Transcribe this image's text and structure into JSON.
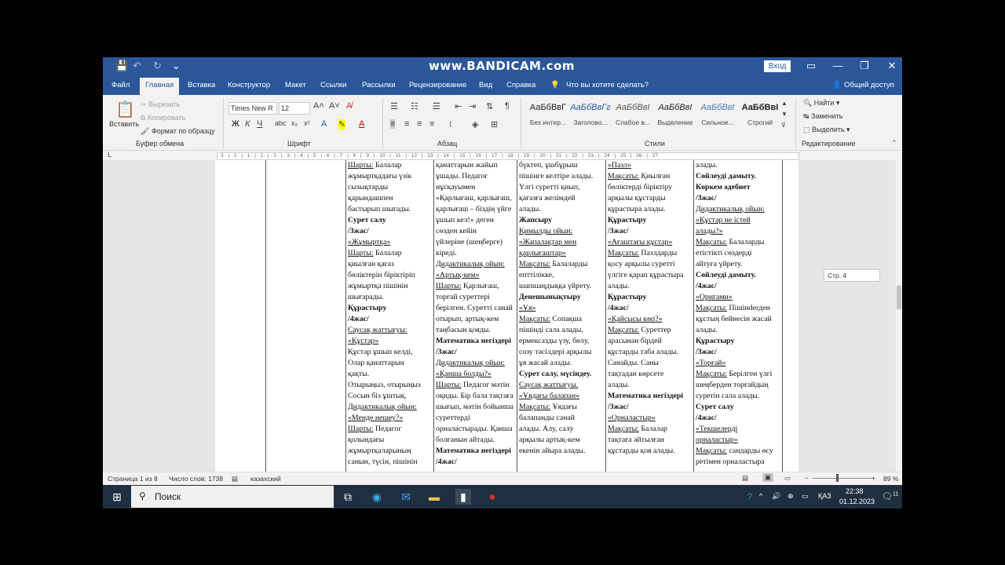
{
  "titlebar": {
    "watermark": "www.BANDICAM.com",
    "sign_in": "Вход",
    "qat_save": "💾",
    "qat_undo": "↶",
    "qat_redo": "↻",
    "qat_more": "⌄",
    "win_ribbon": "▭",
    "win_min": "—",
    "win_max": "❐",
    "win_close": "✕"
  },
  "tabs": [
    "Файл",
    "Главная",
    "Вставка",
    "Конструктор",
    "Макет",
    "Ссылки",
    "Рассылки",
    "Рецензирование",
    "Вид",
    "Справка"
  ],
  "tell_me": "Что вы хотите сделать?",
  "share": "Общий доступ",
  "ribbon": {
    "clipboard": {
      "label": "Буфер обмена",
      "paste": "Вставить",
      "cut": "Вырезать",
      "copy": "Копировать",
      "format_painter": "Формат по образцу"
    },
    "font": {
      "label": "Шрифт",
      "name": "Times New R",
      "size": "12"
    },
    "paragraph": {
      "label": "Абзац"
    },
    "styles": {
      "label": "Стили",
      "items": [
        {
          "sample": "АаБбВвГ",
          "name": "Без интер..."
        },
        {
          "sample": "АаБбВвГг",
          "name": "Заголово..."
        },
        {
          "sample": "АаБбВвІ",
          "name": "Слабое в..."
        },
        {
          "sample": "АаБбВвІ",
          "name": "Выделение"
        },
        {
          "sample": "АаБбВвІ",
          "name": "Сильное..."
        },
        {
          "sample": "АаБбВвІ",
          "name": "Строгий"
        }
      ]
    },
    "editing": {
      "label": "Редактирование",
      "find": "Найти",
      "replace": "Заменить",
      "select": "Выделить"
    }
  },
  "ruler": "· 3 · | · 2 · | · 1 · | · 1 · | · 2 · | · 3 · | · 4 · | · 5 · | · 6 · | · 7 · | · 8 · | · 9 · | · 10 · | · 11 · | · 12 · | · 13 · | · 14 · | · 15 · | · 16 · | · 17 · | · 18 · | · 19 · | · 20 · | · 21 · | · 22 · | · 23 · | · 24 · | · 25 · | · 26 · | · 27",
  "page_tip": "Стр. 4",
  "columns": [
    [
      {
        "t": "Шарты: Балалар",
        "s": "u1"
      },
      {
        "t": "жұмыртқадағы үзік"
      },
      {
        "t": "сызықтарды"
      },
      {
        "t": "қарындашпен"
      },
      {
        "t": "бастырып шығады."
      },
      {
        "t": "Сурет салу",
        "s": "b"
      },
      {
        "t": "/3жас/",
        "s": "b"
      },
      {
        "t": "«Жұмыртқа»",
        "s": "u"
      },
      {
        "t": "Шарты: Балалар",
        "s": "u1"
      },
      {
        "t": "қиылған қағаз"
      },
      {
        "t": "бөліктерін біріктіріп"
      },
      {
        "t": "жұмыртқа пішінін"
      },
      {
        "t": "шығарады."
      },
      {
        "t": "Құрастыру",
        "s": "b"
      },
      {
        "t": "/4жас/",
        "s": "b"
      },
      {
        "t": "Саусақ жаттығуы:",
        "s": "u"
      },
      {
        "t": "«Құстар»",
        "s": "u"
      },
      {
        "t": "Құстар ұшып келді,"
      },
      {
        "t": "Олар қанаттарын"
      },
      {
        "t": "қақты."
      },
      {
        "t": "Отырыңыз, отырыңыз"
      },
      {
        "t": "Сосын біз ұштық."
      },
      {
        "t": "Дидактикалық ойын:",
        "s": "u"
      },
      {
        "t": "«Менде нешеу?»",
        "s": "u"
      },
      {
        "t": "Шарты: Педагог",
        "s": "u1"
      },
      {
        "t": "қолындағы"
      },
      {
        "t": "жұмыртқаларының"
      },
      {
        "t": "санын, түсін, пішінін"
      }
    ],
    [
      {
        "t": "қанаттарын жайып"
      },
      {
        "t": "ұшады.  Педагог"
      },
      {
        "t": "нұсқауымен"
      },
      {
        "t": "«Қарлығаш, қарлығаш,"
      },
      {
        "t": "қарлығаш – біздің үйге"
      },
      {
        "t": "ұшып кел!» деген"
      },
      {
        "t": "сөзден кейін"
      },
      {
        "t": "үйлеріне (шеңберге)"
      },
      {
        "t": "кіреді."
      },
      {
        "t": "Дидактикалық ойын:",
        "s": "u"
      },
      {
        "t": "«Артық-кем»",
        "s": "u"
      },
      {
        "t": "Шарты: Қарлығаш,",
        "s": "u1"
      },
      {
        "t": "торғай суреттері"
      },
      {
        "t": "берілген. Суретті санай"
      },
      {
        "t": "отырып, артық-кем"
      },
      {
        "t": "таңбасын қояды."
      },
      {
        "t": "Математика негіздері",
        "s": "b"
      },
      {
        "t": "/3жас/",
        "s": "b"
      },
      {
        "t": "Дидактикалық ойын:",
        "s": "u"
      },
      {
        "t": "«Қанша болды?»",
        "s": "u"
      },
      {
        "t": "Шарты: Педагог мәтін",
        "s": "u1"
      },
      {
        "t": "оқиды. Бір бала тақтаға"
      },
      {
        "t": "шығып, мәтін бойынша"
      },
      {
        "t": "суреттерді"
      },
      {
        "t": "орналастырады. Қанша"
      },
      {
        "t": "болғанын айтады."
      },
      {
        "t": "Математика негіздері",
        "s": "b"
      },
      {
        "t": "/4жас/",
        "s": "b"
      }
    ],
    [
      {
        "t": "бүктеп, ұшбұрыш"
      },
      {
        "t": "пішінге келтіре алады."
      },
      {
        "t": "Үлгі суретті қиып,"
      },
      {
        "t": "қағазға желімдей"
      },
      {
        "t": "алады."
      },
      {
        "t": "Жапсыру",
        "s": "b"
      },
      {
        "t": "Қимылды ойын:",
        "s": "u"
      },
      {
        "t": "«Жапалақтар мен",
        "s": "u"
      },
      {
        "t": "қарлығаштар»",
        "s": "u"
      },
      {
        "t": "Мақсаты: Балаларды",
        "s": "u1"
      },
      {
        "t": "епттілікке,"
      },
      {
        "t": "шапшаңдыққа үйрету."
      },
      {
        "t": "Денешынықтыру",
        "s": "b"
      },
      {
        "t": "«Ұя»",
        "s": "u"
      },
      {
        "t": "Мақсаты: Сопақша",
        "s": "u1"
      },
      {
        "t": "пішінді сала алады,"
      },
      {
        "t": "ермексазды үзу, бөлу,"
      },
      {
        "t": "созу тәсілдері арқылы"
      },
      {
        "t": "ұя жасай алады."
      },
      {
        "t": "Сурет салу, мүсіндеу.",
        "s": "b"
      },
      {
        "t": "Саусақ жаттығуы.",
        "s": "u"
      },
      {
        "t": ""
      },
      {
        "t": "«Ұядағы балапан»",
        "s": "u"
      },
      {
        "t": "Мақсаты: Ұядағы",
        "s": "u1"
      },
      {
        "t": "балапанды санай"
      },
      {
        "t": "алады. Алу, салу"
      },
      {
        "t": "арқылы артық-кем"
      },
      {
        "t": "екенін айыра алады."
      }
    ],
    [
      {
        "t": "«Пазл»",
        "s": "u"
      },
      {
        "t": "Мақсаты: Қиылған",
        "s": "u1"
      },
      {
        "t": "бөліктерді біріктіру"
      },
      {
        "t": "арқылы құстарды"
      },
      {
        "t": "құрастыра алады."
      },
      {
        "t": "Құрастыру",
        "s": "b"
      },
      {
        "t": "/3жас/",
        "s": "b"
      },
      {
        "t": "«Ағаштағы құстар»",
        "s": "u"
      },
      {
        "t": "Мақсаты:  Пазлдарды",
        "s": "u1"
      },
      {
        "t": "қосу арқылы суретті"
      },
      {
        "t": "үлгіге қарап құрастыра"
      },
      {
        "t": "алады."
      },
      {
        "t": "Құрастыру",
        "s": "b"
      },
      {
        "t": "/4жас/",
        "s": "b"
      },
      {
        "t": "«Қайсысы көп?»",
        "s": "u"
      },
      {
        "t": "Мақсаты: Суреттер",
        "s": "u1"
      },
      {
        "t": "арасынан бірдей"
      },
      {
        "t": "құстарды таба алады."
      },
      {
        "t": "Санайды. Саны"
      },
      {
        "t": "тақтадан көрсете"
      },
      {
        "t": "алады."
      },
      {
        "t": "Математика негіздері",
        "s": "b"
      },
      {
        "t": "/3жас/",
        "s": "b"
      },
      {
        "t": "«Орналастыр»",
        "s": "u"
      },
      {
        "t": "Мақсаты: Балалар",
        "s": "u1"
      },
      {
        "t": "тақтаға айтылған"
      },
      {
        "t": "құстарды қоя алады."
      }
    ],
    [
      {
        "t": "алады."
      },
      {
        "t": "Сөйлеуді дамыту.",
        "s": "b"
      },
      {
        "t": "Көркем әдебиет",
        "s": "b"
      },
      {
        "t": "/3жас/",
        "s": "b"
      },
      {
        "t": "Дидактикалық ойын:",
        "s": "u"
      },
      {
        "t": "«Құстар не істей",
        "s": "u"
      },
      {
        "t": "алады?»",
        "s": "u"
      },
      {
        "t": "Мақсаты: Балаларды",
        "s": "u1"
      },
      {
        "t": "етістікті сөздерді"
      },
      {
        "t": "айтуға үйрету."
      },
      {
        "t": "Сөйлеуді дамыту.",
        "s": "b"
      },
      {
        "t": "/4жас/",
        "s": "b"
      },
      {
        "t": " «Оригами»",
        "s": "u"
      },
      {
        "t": "Мақсаты: Пішінderден",
        "s": "u1"
      },
      {
        "t": "құстың бейнесін жасай"
      },
      {
        "t": "алады."
      },
      {
        "t": "Құрастыру",
        "s": "b"
      },
      {
        "t": "/3жас/",
        "s": "b"
      },
      {
        "t": "«Торғай»",
        "s": "u"
      },
      {
        "t": "Мақсаты: Берілген үлгі",
        "s": "u1"
      },
      {
        "t": "шеңберден торғайдың"
      },
      {
        "t": "суретін сала алады."
      },
      {
        "t": "Сурет салу",
        "s": "b"
      },
      {
        "t": "/4жас/",
        "s": "b"
      },
      {
        "t": "«Текшелерді",
        "s": "u"
      },
      {
        "t": "орналастыр»",
        "s": "u"
      },
      {
        "t": "Мақсаты: сандарды өсу",
        "s": "u1"
      },
      {
        "t": "ретімен орналастыра"
      }
    ]
  ],
  "status": {
    "page": "Страница 1 из 8",
    "words": "Число слов: 1738",
    "lang": "казахский",
    "zoom": "89 %"
  },
  "taskbar": {
    "search": "Поиск",
    "lang": "ҚАЗ",
    "time": "22:38",
    "date": "01.12.2023",
    "notif": "11"
  }
}
